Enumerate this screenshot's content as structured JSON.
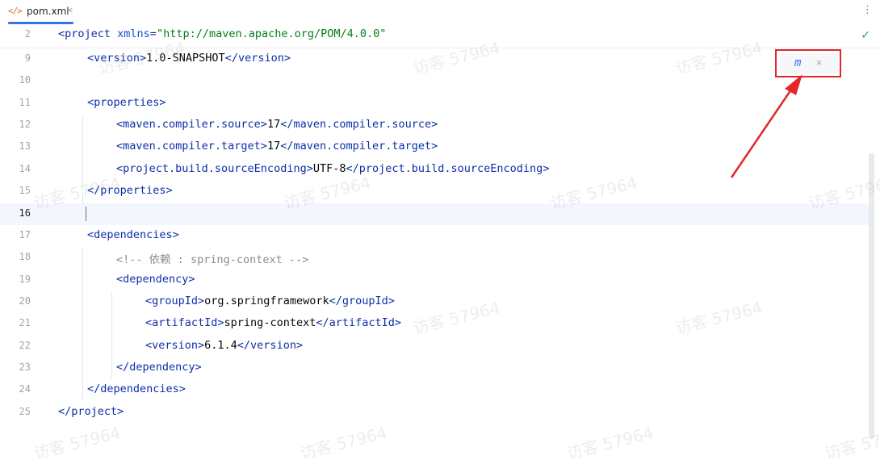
{
  "tab": {
    "icon": "</>",
    "title": "pom.xml",
    "close": "×"
  },
  "editor_menu": "⋮",
  "inspection_status": "✓",
  "maven_popup": {
    "icon": "maven-load-changes-icon",
    "icon_glyph": "m",
    "close": "×"
  },
  "watermark": "访客 57964",
  "lines": [
    {
      "n": "2",
      "segments": [
        {
          "c": "tag",
          "t": "<project "
        },
        {
          "c": "attr",
          "t": "xmlns"
        },
        {
          "c": "tag",
          "t": "="
        },
        {
          "c": "str",
          "t": "\"http://maven.apache.org/POM/4.0.0\""
        }
      ]
    },
    {
      "n": "9",
      "segments": [
        {
          "c": "tag",
          "t": "<version>"
        },
        {
          "c": "txt",
          "t": "1.0-SNAPSHOT"
        },
        {
          "c": "tag",
          "t": "</version>"
        }
      ]
    },
    {
      "n": "10",
      "segments": []
    },
    {
      "n": "11",
      "segments": [
        {
          "c": "tag",
          "t": "<properties>"
        }
      ]
    },
    {
      "n": "12",
      "segments": [
        {
          "c": "tag",
          "t": "<maven.compiler.source>"
        },
        {
          "c": "txt",
          "t": "17"
        },
        {
          "c": "tag",
          "t": "</maven.compiler.source>"
        }
      ]
    },
    {
      "n": "13",
      "segments": [
        {
          "c": "tag",
          "t": "<maven.compiler.target>"
        },
        {
          "c": "txt",
          "t": "17"
        },
        {
          "c": "tag",
          "t": "</maven.compiler.target>"
        }
      ]
    },
    {
      "n": "14",
      "segments": [
        {
          "c": "tag",
          "t": "<project.build.sourceEncoding>"
        },
        {
          "c": "txt",
          "t": "UTF-8"
        },
        {
          "c": "tag",
          "t": "</project.build.sourceEncoding>"
        }
      ]
    },
    {
      "n": "15",
      "segments": [
        {
          "c": "tag",
          "t": "</properties>"
        }
      ]
    },
    {
      "n": "16",
      "segments": []
    },
    {
      "n": "17",
      "segments": [
        {
          "c": "tag",
          "t": "<dependencies>"
        }
      ]
    },
    {
      "n": "18",
      "segments": [
        {
          "c": "cmt",
          "t": "<!-- 依赖 : spring-context -->"
        }
      ]
    },
    {
      "n": "19",
      "segments": [
        {
          "c": "tag",
          "t": "<dependency>"
        }
      ]
    },
    {
      "n": "20",
      "segments": [
        {
          "c": "tag",
          "t": "<groupId>"
        },
        {
          "c": "txt",
          "t": "org.springframework"
        },
        {
          "c": "tag",
          "t": "</groupId>"
        }
      ]
    },
    {
      "n": "21",
      "segments": [
        {
          "c": "tag",
          "t": "<artifactId>"
        },
        {
          "c": "txt",
          "t": "spring-context"
        },
        {
          "c": "tag",
          "t": "</artifactId>"
        }
      ]
    },
    {
      "n": "22",
      "segments": [
        {
          "c": "tag",
          "t": "<version>"
        },
        {
          "c": "txt",
          "t": "6.1.4"
        },
        {
          "c": "tag",
          "t": "</version>"
        }
      ]
    },
    {
      "n": "23",
      "segments": [
        {
          "c": "tag",
          "t": "</dependency>"
        }
      ]
    },
    {
      "n": "24",
      "segments": [
        {
          "c": "tag",
          "t": "</dependencies>"
        }
      ]
    },
    {
      "n": "25",
      "segments": [
        {
          "c": "tag",
          "t": "</project>"
        }
      ]
    }
  ],
  "current_line": "16",
  "colors": {
    "tag": "#0b2fa8",
    "string": "#067d17",
    "comment": "#8c8c8c",
    "accent": "#3574f0",
    "annotation": "#e3262a"
  }
}
